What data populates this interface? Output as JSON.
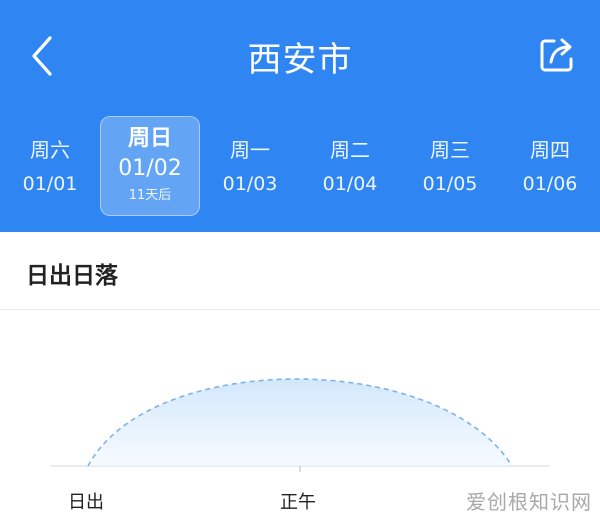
{
  "header": {
    "title": "西安市",
    "back_icon": "chevron-left-icon",
    "share_icon": "share-icon",
    "background": "#2f86f2"
  },
  "days": [
    {
      "week": "周六",
      "date": "01/01"
    },
    {
      "week": "周日",
      "date": "01/02",
      "note": "11天后",
      "selected": true
    },
    {
      "week": "周一",
      "date": "01/03"
    },
    {
      "week": "周二",
      "date": "01/04"
    },
    {
      "week": "周三",
      "date": "01/05"
    },
    {
      "week": "周四",
      "date": "01/06"
    }
  ],
  "sun_section": {
    "title": "日出日落",
    "sunrise_label": "日出",
    "noon_label": "正午"
  },
  "watermark": "爱创根知识网"
}
